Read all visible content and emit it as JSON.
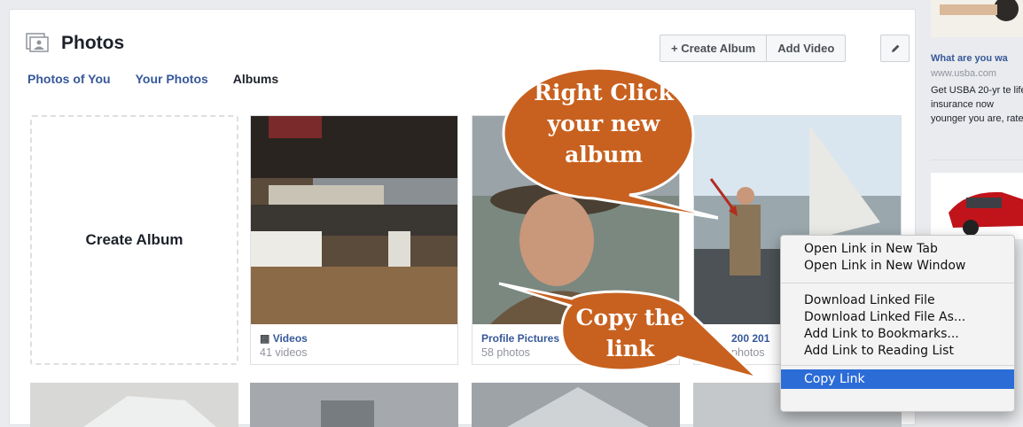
{
  "header": {
    "title": "Photos"
  },
  "tabs": [
    {
      "label": "Photos of You"
    },
    {
      "label": "Your Photos"
    },
    {
      "label": "Albums"
    }
  ],
  "toolbar": {
    "create_album_label": "+ Create Album",
    "add_video_label": "Add Video",
    "edit_icon": "pencil-icon"
  },
  "create_tile": {
    "label": "Create Album"
  },
  "albums": [
    {
      "name": "Videos",
      "count": "41 videos",
      "icon": "video-camera-icon"
    },
    {
      "name": "Profile Pictures",
      "count": "58 photos"
    },
    {
      "name": "200 201",
      "count": "photos"
    }
  ],
  "ad": {
    "title": "What are you wa",
    "url": "www.usba.com",
    "text": "Get USBA 20-yr te life insurance now younger you are, rate!"
  },
  "callouts": {
    "top_lines": [
      "Right Click",
      "your new",
      "album"
    ],
    "bottom_lines": [
      "Copy the",
      "link"
    ],
    "color": "#c8611f"
  },
  "context_menu": {
    "items_group1": [
      "Open Link in New Tab",
      "Open Link in New Window"
    ],
    "items_group2": [
      "Download Linked File",
      "Download Linked File As...",
      "Add Link to Bookmarks...",
      "Add Link to Reading List"
    ],
    "highlighted_item": "Copy Link",
    "highlight_color": "#2c6cd7"
  }
}
